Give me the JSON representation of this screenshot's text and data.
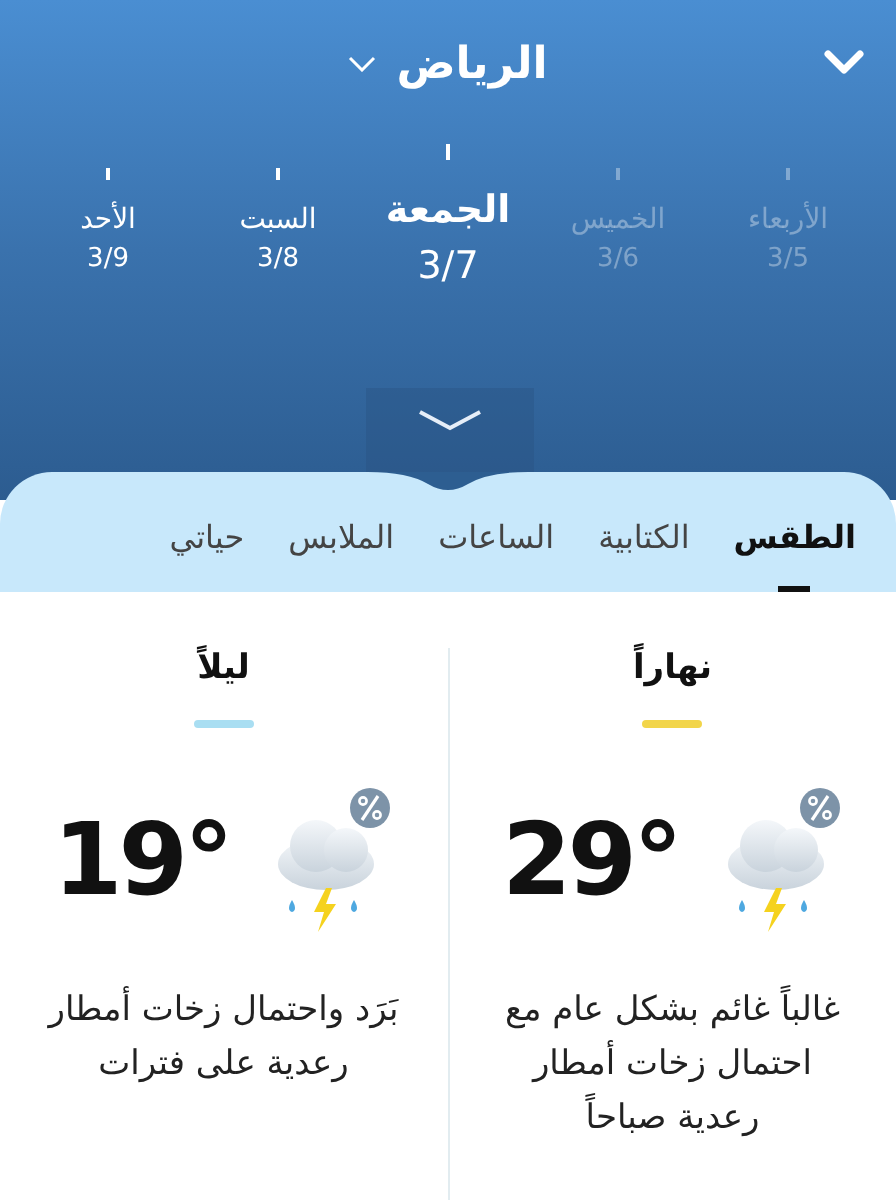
{
  "header": {
    "city": "الرياض"
  },
  "days": [
    {
      "name": "الأربعاء",
      "date": "3/5",
      "selected": false,
      "past": true
    },
    {
      "name": "الخميس",
      "date": "3/6",
      "selected": false,
      "past": true
    },
    {
      "name": "الجمعة",
      "date": "3/7",
      "selected": true,
      "past": false
    },
    {
      "name": "السبت",
      "date": "3/8",
      "selected": false,
      "past": false
    },
    {
      "name": "الأحد",
      "date": "3/9",
      "selected": false,
      "past": false
    }
  ],
  "tabs": [
    {
      "label": "الطقس",
      "selected": true
    },
    {
      "label": "الكتابية",
      "selected": false
    },
    {
      "label": "الساعات",
      "selected": false
    },
    {
      "label": "الملابس",
      "selected": false
    },
    {
      "label": "حياتي",
      "selected": false
    }
  ],
  "periods": [
    {
      "label": "نهاراً",
      "color": "#f2d54a",
      "temperature": "29°",
      "description": "غالباً غائم بشكل عام مع احتمال زخات أمطار رعدية صباحاً"
    },
    {
      "label": "ليلاً",
      "color": "#a9def2",
      "temperature": "19°",
      "description": "بَرَد واحتمال زخات أمطار رعدية على فترات"
    }
  ]
}
